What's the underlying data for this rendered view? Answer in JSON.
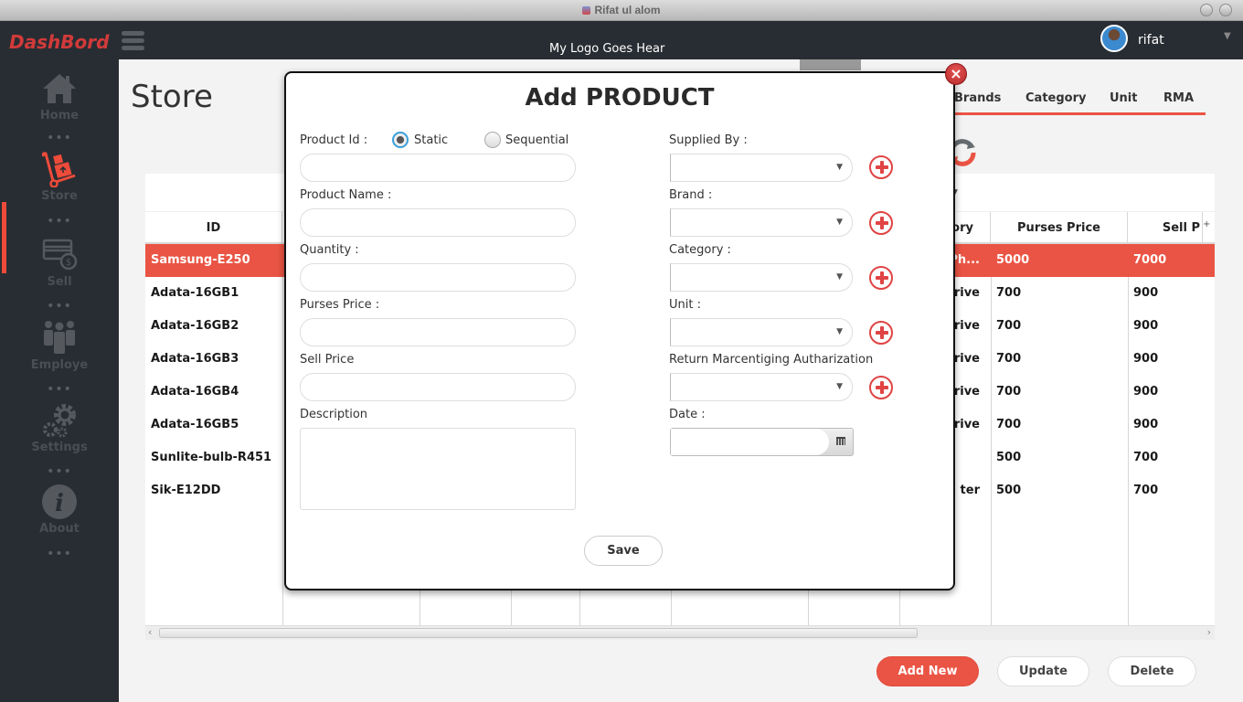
{
  "window": {
    "title": "Rifat ul alom"
  },
  "header": {
    "brand": "DashBord",
    "logo_text": "My Logo Goes Hear",
    "username": "rifat"
  },
  "sidebar": {
    "items": [
      {
        "label": "Home",
        "icon": "home-icon",
        "active": false
      },
      {
        "label": "Store",
        "icon": "hand-truck-icon",
        "active": true
      },
      {
        "label": "Sell",
        "icon": "card-dollar-icon",
        "active": false
      },
      {
        "label": "Employe",
        "icon": "people-icon",
        "active": false
      },
      {
        "label": "Settings",
        "icon": "gears-icon",
        "active": false
      },
      {
        "label": "About",
        "icon": "info-icon",
        "active": false
      }
    ],
    "dots": "•••"
  },
  "page": {
    "title": "Store"
  },
  "tabs": [
    {
      "label": "Brands"
    },
    {
      "label": "Category"
    },
    {
      "label": "Unit"
    },
    {
      "label": "RMA"
    }
  ],
  "table": {
    "columns": [
      "ID",
      "",
      "",
      "",
      "",
      "",
      "",
      "ory",
      "Purses Price",
      "Sell P"
    ],
    "rows": [
      {
        "id": "Samsung-E250",
        "category": "Ph...",
        "purses_price": "5000",
        "sell_price": "7000",
        "selected": true
      },
      {
        "id": "Adata-16GB1",
        "category": "rive",
        "purses_price": "700",
        "sell_price": "900",
        "selected": false
      },
      {
        "id": "Adata-16GB2",
        "category": "rive",
        "purses_price": "700",
        "sell_price": "900",
        "selected": false
      },
      {
        "id": "Adata-16GB3",
        "category": "rive",
        "purses_price": "700",
        "sell_price": "900",
        "selected": false
      },
      {
        "id": "Adata-16GB4",
        "category": "rive",
        "purses_price": "700",
        "sell_price": "900",
        "selected": false
      },
      {
        "id": "Adata-16GB5",
        "category": "rive",
        "purses_price": "700",
        "sell_price": "900",
        "selected": false
      },
      {
        "id": "Sunlite-bulb-R451",
        "category": "",
        "purses_price": "500",
        "sell_price": "700",
        "selected": false
      },
      {
        "id": "Sik-E12DD",
        "category": "ter",
        "purses_price": "500",
        "sell_price": "700",
        "selected": false
      }
    ]
  },
  "actions": {
    "add_new": "Add New",
    "update": "Update",
    "delete": "Delete"
  },
  "modal": {
    "title": "Add PRODUCT",
    "close": "×",
    "product_id_label": "Product Id :",
    "radio_static": "Static",
    "radio_sequential": "Sequential",
    "radio_selected": "Static",
    "product_name_label": "Product Name :",
    "quantity_label": "Quantity :",
    "purses_price_label": "Purses Price :",
    "sell_price_label": "Sell Price",
    "description_label": "Description",
    "supplied_by_label": "Supplied By :",
    "brand_label": "Brand :",
    "category_label": "Category :",
    "unit_label": "Unit :",
    "rma_label": "Return Marcentiging Autharization",
    "date_label": "Date :",
    "save": "Save",
    "values": {
      "product_id": "",
      "product_name": "",
      "quantity": "",
      "purses_price": "",
      "sell_price": "",
      "description": "",
      "supplied_by": "",
      "brand": "",
      "category": "",
      "unit": "",
      "rma": "",
      "date": ""
    }
  }
}
